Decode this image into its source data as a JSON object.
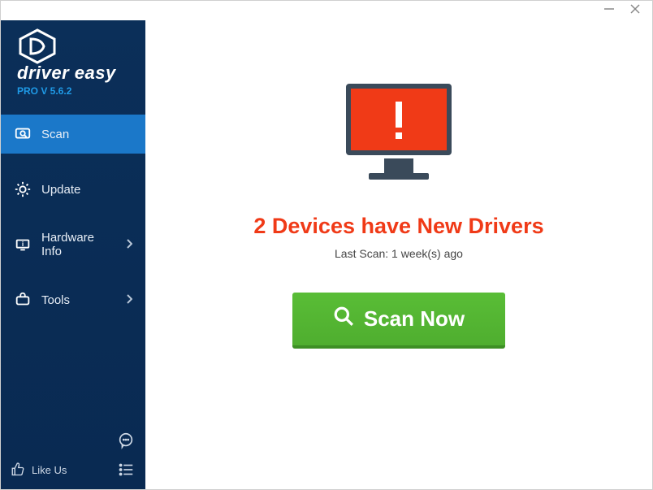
{
  "app": {
    "brand": "driver easy",
    "version_label": "PRO V 5.6.2"
  },
  "sidebar": {
    "items": [
      {
        "label": "Scan"
      },
      {
        "label": "Update"
      },
      {
        "label": "Hardware Info"
      },
      {
        "label": "Tools"
      }
    ],
    "like_us": "Like Us"
  },
  "main": {
    "headline": "2 Devices have New Drivers",
    "last_scan": "Last Scan: 1 week(s) ago",
    "scan_button": "Scan Now"
  }
}
